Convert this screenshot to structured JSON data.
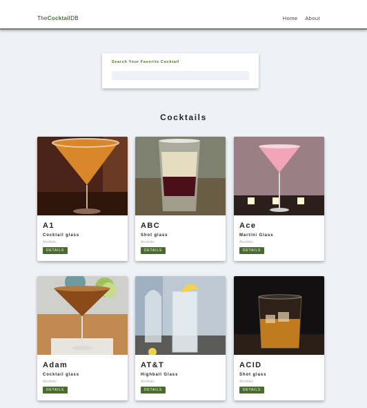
{
  "navbar": {
    "logo_prefix": "The",
    "logo_brand": "Cocktail",
    "logo_suffix": "DB",
    "links": [
      {
        "label": "Home"
      },
      {
        "label": "About"
      }
    ]
  },
  "search": {
    "label": "Search Your Favorite Cocktail",
    "value": "",
    "placeholder": ""
  },
  "section_title": "Cocktails",
  "button_label": "DETAILS",
  "cocktails": [
    {
      "name": "A1",
      "glass": "Cocktail glass",
      "info": "Alcoholic"
    },
    {
      "name": "ABC",
      "glass": "Shot glass",
      "info": "Alcoholic"
    },
    {
      "name": "Ace",
      "glass": "Martini Glass",
      "info": "Alcoholic"
    },
    {
      "name": "Adam",
      "glass": "Cocktail glass",
      "info": "Alcoholic"
    },
    {
      "name": "AT&T",
      "glass": "Highball Glass",
      "info": "Alcoholic"
    },
    {
      "name": "ACID",
      "glass": "Shot glass",
      "info": "Alcoholic"
    }
  ],
  "colors": {
    "accent": "#4a6b2e",
    "background": "#eef2f6"
  }
}
